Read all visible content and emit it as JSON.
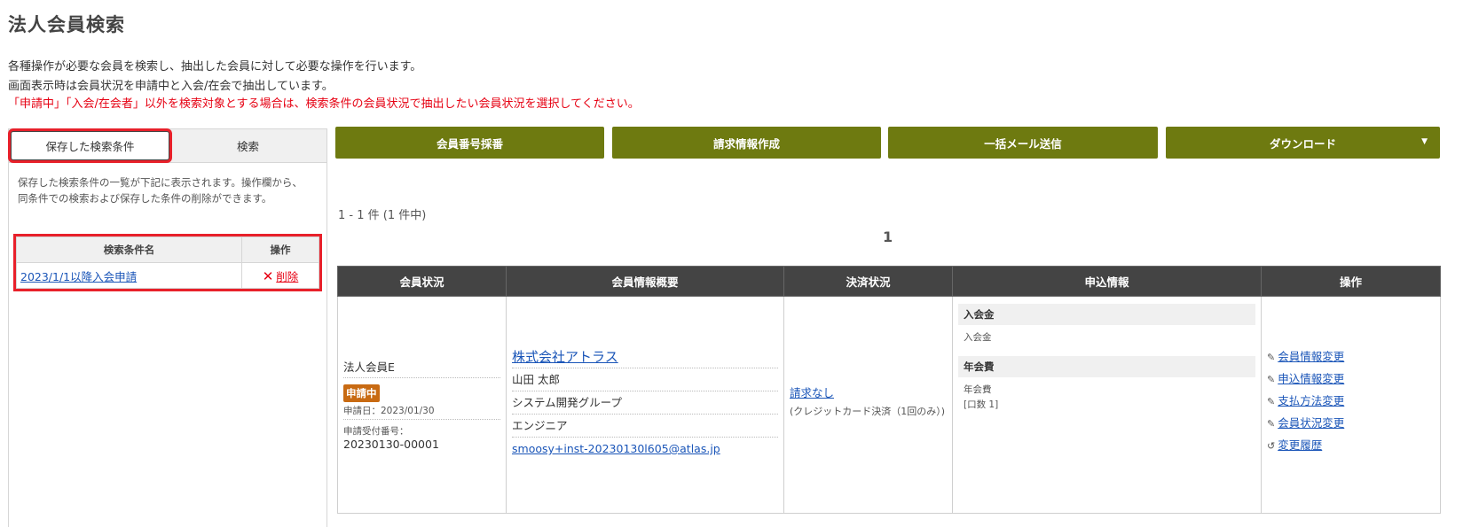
{
  "page": {
    "title": "法人会員検索",
    "desc1": "各種操作が必要な会員を検索し、抽出した会員に対して必要な操作を行います。",
    "desc2": "画面表示時は会員状況を申請中と入会/在会で抽出しています。",
    "desc3": "「申請中」「入会/在会者」以外を検索対象とする場合は、検索条件の会員状況で抽出したい会員状況を選択してください。"
  },
  "left": {
    "tab_saved": "保存した検索条件",
    "tab_search": "検索",
    "help1": "保存した検索条件の一覧が下記に表示されます。操作欄から、",
    "help2": "同条件での検索および保存した条件の削除ができます。",
    "col_name": "検索条件名",
    "col_op": "操作",
    "row_name": "2023/1/1以降入会申請",
    "row_delete": "削除"
  },
  "buttons": {
    "assign": "会員番号採番",
    "invoice": "請求情報作成",
    "mail": "一括メール送信",
    "download": "ダウンロード"
  },
  "results": {
    "count": "1 - 1 件 (1 件中)",
    "page": "1",
    "headers": [
      "会員状況",
      "会員情報概要",
      "決済状況",
      "申込情報",
      "操作"
    ],
    "status": {
      "type": "法人会員E",
      "badge": "申請中",
      "date": "申請日：2023/01/30",
      "recv_label": "申請受付番号：",
      "recv_no": "20230130-00001"
    },
    "member": {
      "company": "株式会社アトラス",
      "name": "山田 太郎",
      "dept": "システム開発グループ",
      "role": "エンジニア",
      "email": "smoosy+inst-20230130l605@atlas.jp"
    },
    "payment": {
      "status": "請求なし",
      "method": "(クレジットカード決済（1回のみ）)"
    },
    "apply": {
      "fee1_head": "入会金",
      "fee1_item": "入会金",
      "fee2_head": "年会費",
      "fee2_item": "年会費",
      "fee2_units": "[口数 1]"
    },
    "ops": {
      "op1": "会員情報変更",
      "op2": "申込情報変更",
      "op3": "支払方法変更",
      "op4": "会員状況変更",
      "op5": "変更履歴"
    }
  },
  "colors": {
    "accent_olive": "#6e7a10",
    "highlight_red": "#e8202a",
    "badge_orange": "#c86a12",
    "header_dark": "#444444"
  }
}
